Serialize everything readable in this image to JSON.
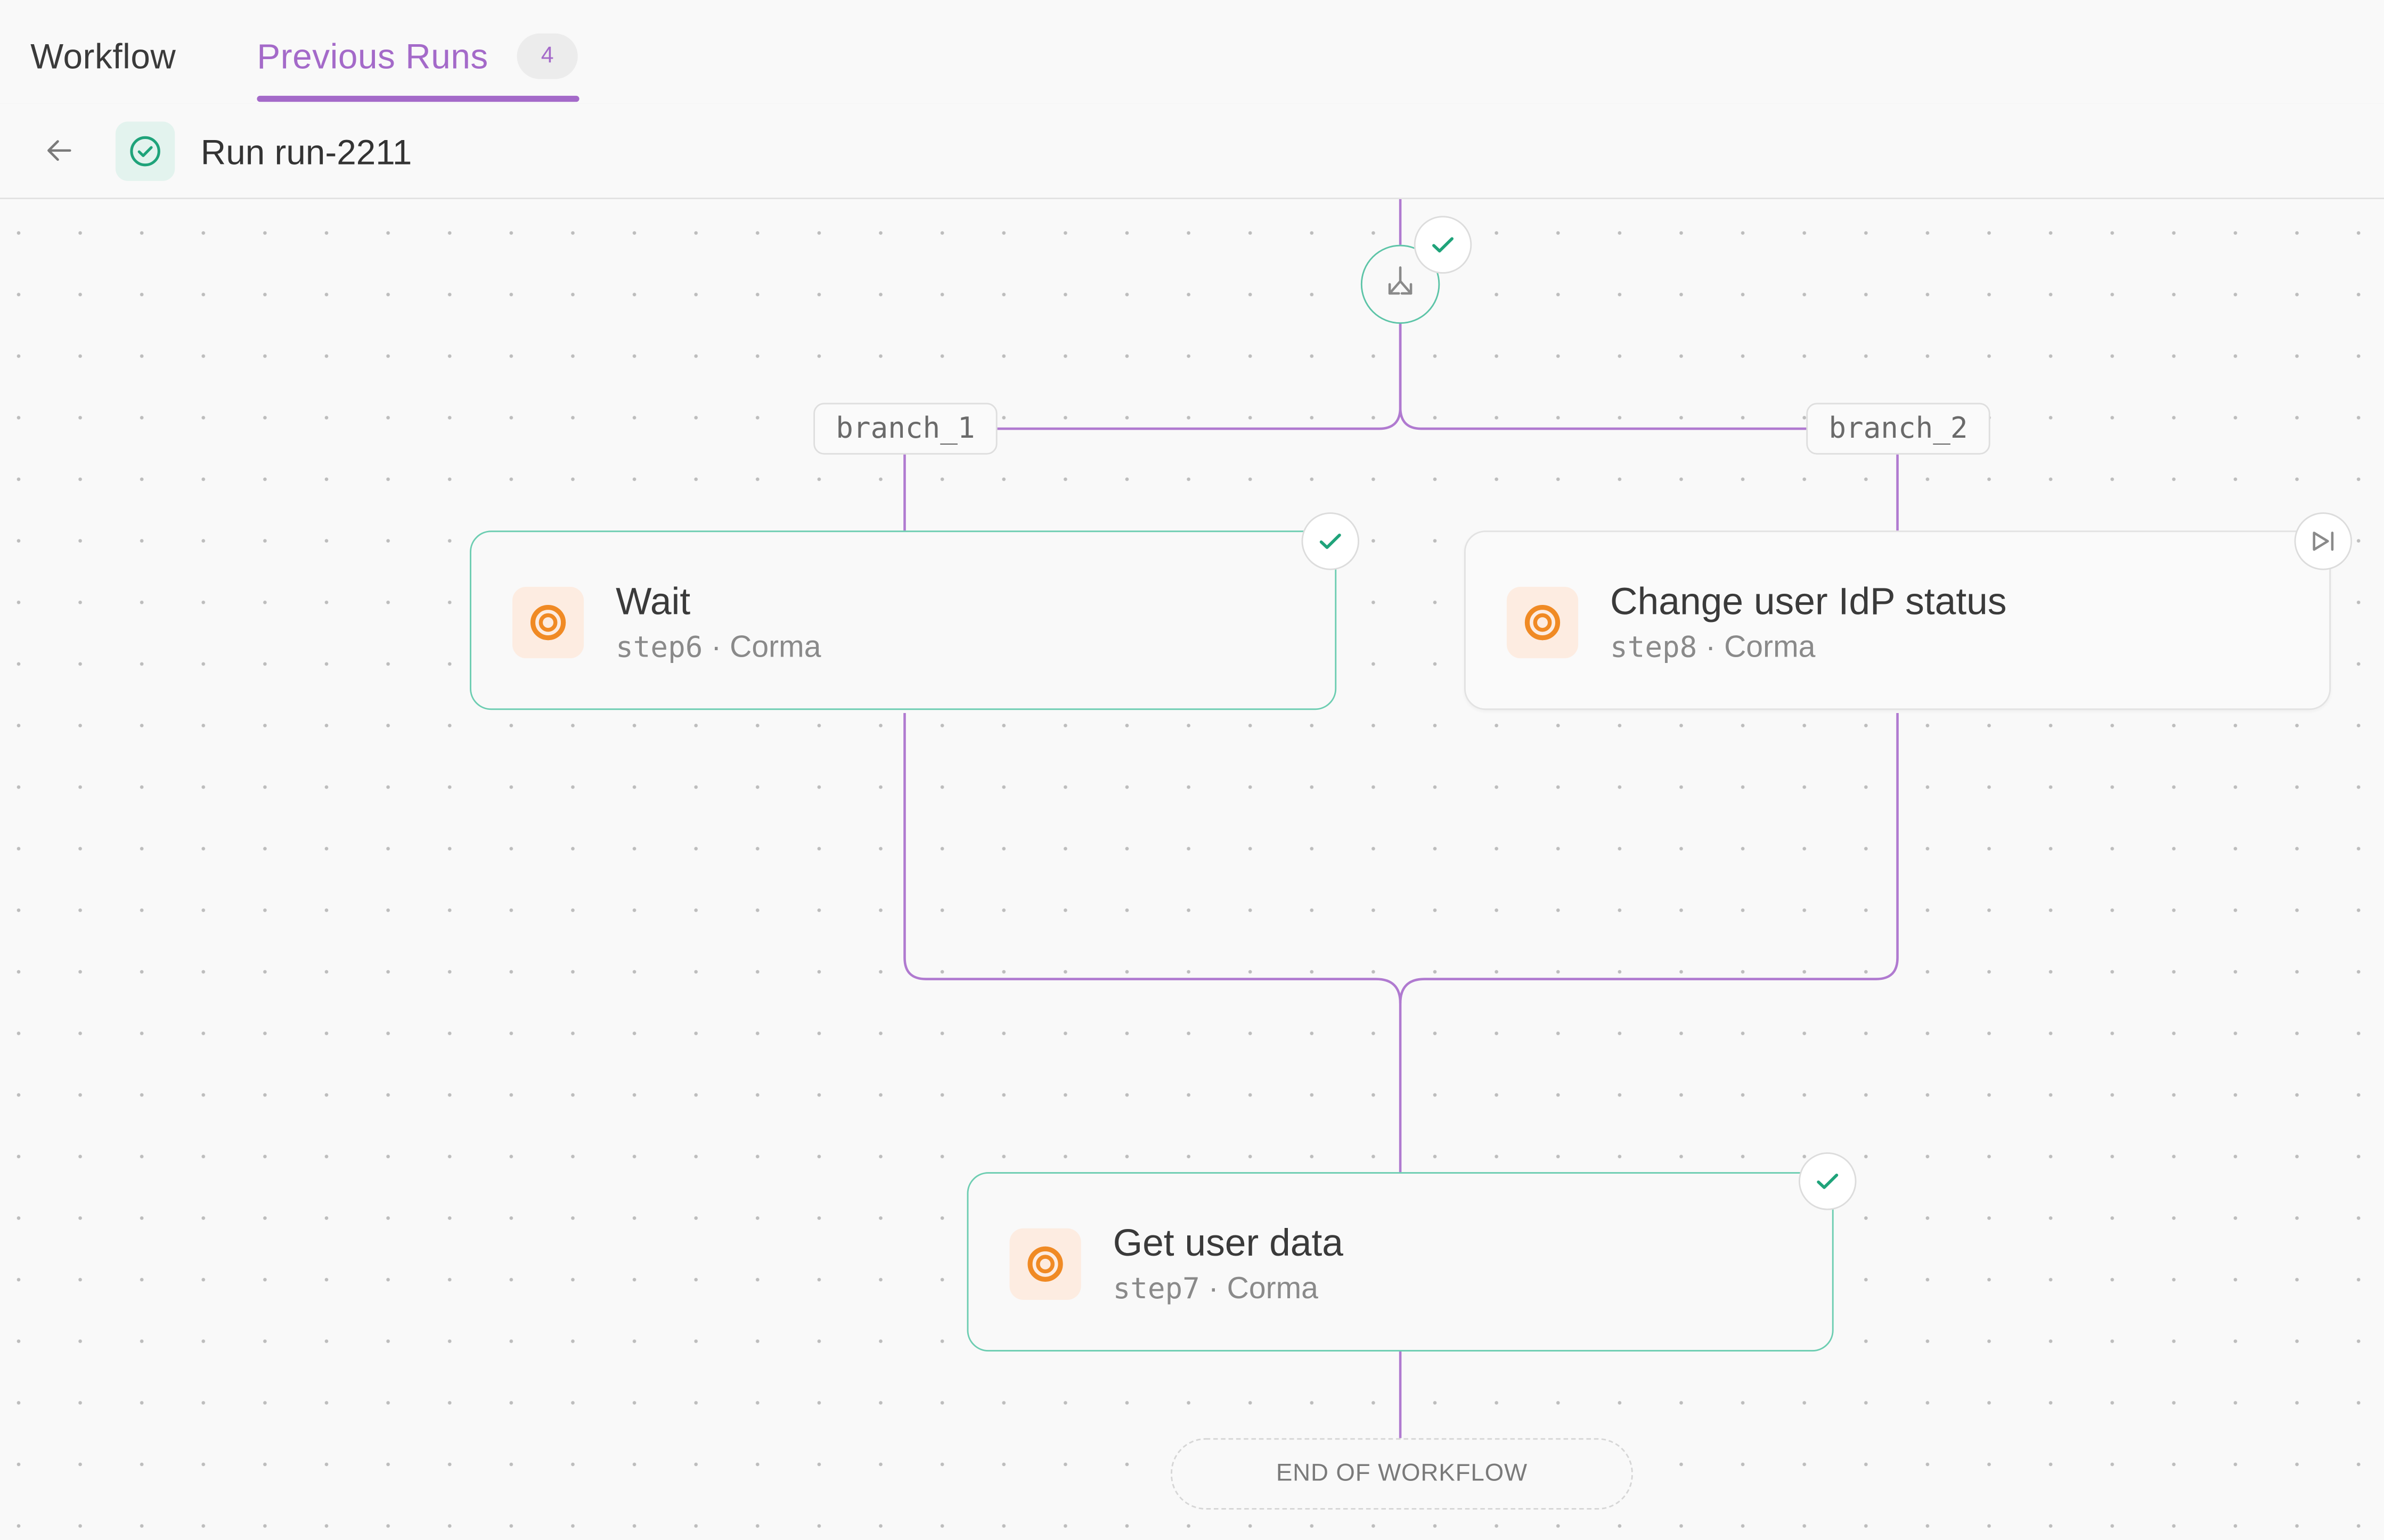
{
  "tabs": {
    "workflow_label": "Workflow",
    "previous_runs_label": "Previous Runs",
    "previous_runs_count": "4",
    "active": "Previous Runs"
  },
  "run": {
    "title": "Run run-2211",
    "status": "success"
  },
  "flow": {
    "branch_1_label": "branch_1",
    "branch_2_label": "branch_2",
    "steps": [
      {
        "title": "Wait",
        "step_id": "step6",
        "separator": " · ",
        "integration": "Corma",
        "status": "success",
        "icon": "corma-logo-icon"
      },
      {
        "title": "Change user IdP status",
        "step_id": "step8",
        "separator": " · ",
        "integration": "Corma",
        "status": "skipped",
        "icon": "corma-logo-icon"
      },
      {
        "title": "Get user data",
        "step_id": "step7",
        "separator": " · ",
        "integration": "Corma",
        "status": "success",
        "icon": "corma-logo-icon"
      }
    ],
    "end_label": "END OF WORKFLOW"
  },
  "colors": {
    "accent_purple": "#a46ac9",
    "success_green": "#5cc4a7",
    "check_green": "#1fa37a",
    "corma_orange": "#f08a24",
    "connector": "#b07ad0"
  }
}
